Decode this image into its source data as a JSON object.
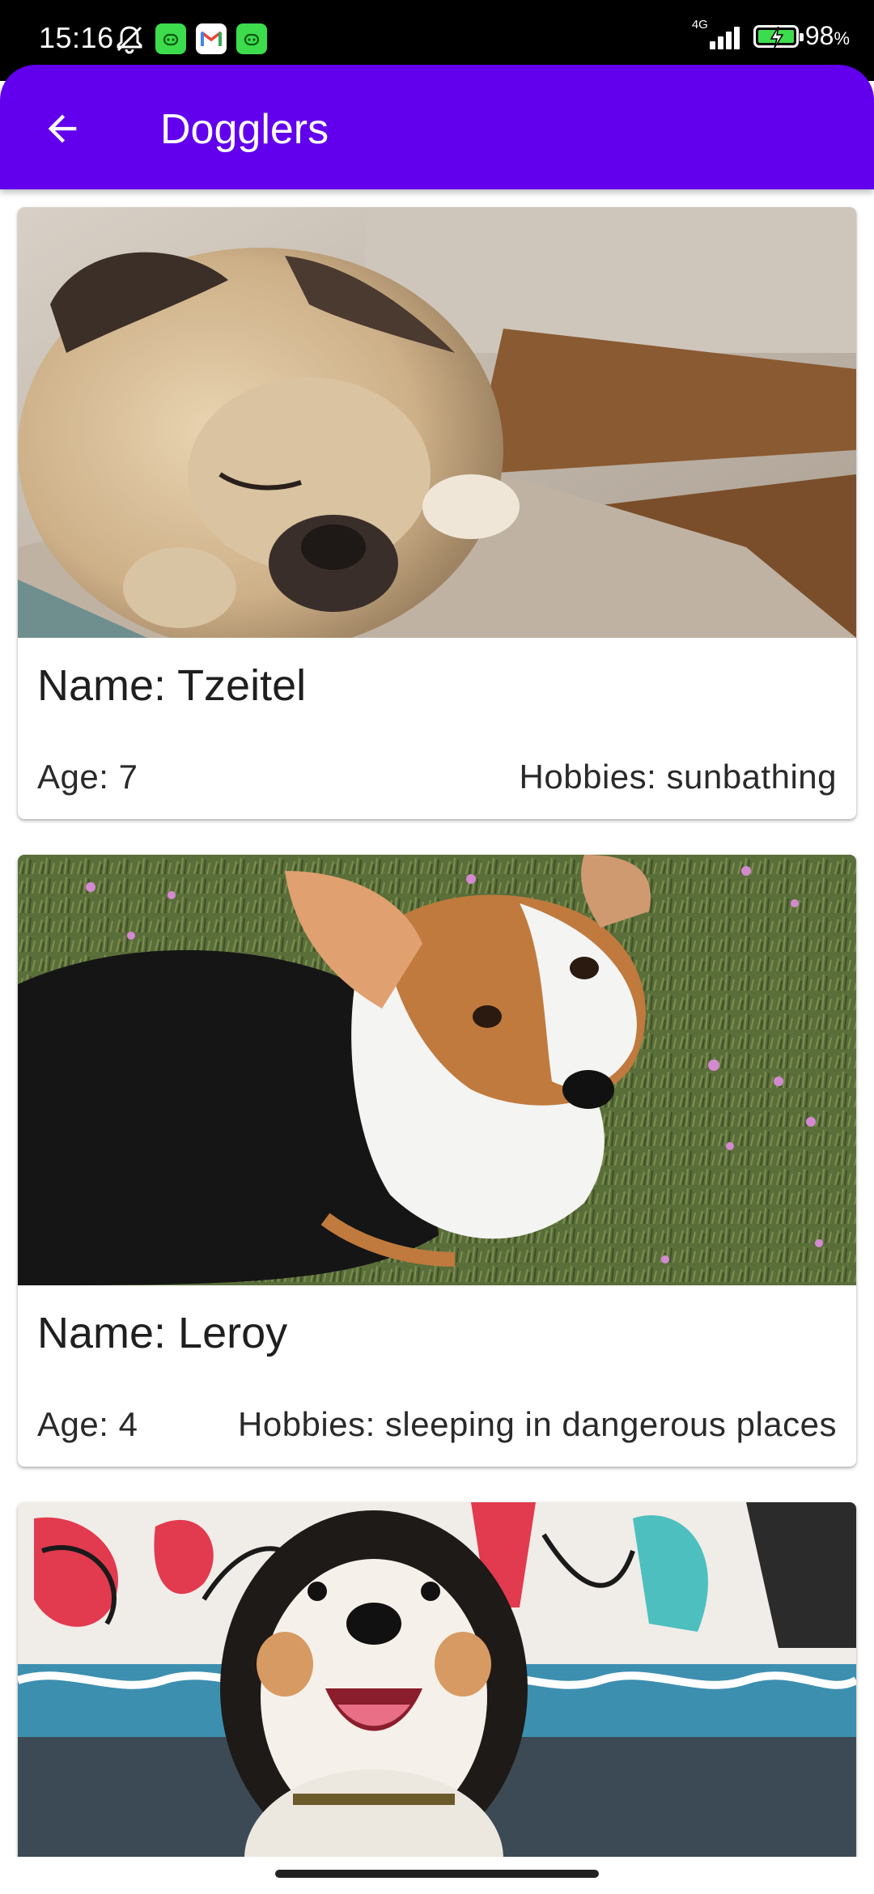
{
  "status_bar": {
    "time": "15:16",
    "network": "4G",
    "battery_percent": "98",
    "battery_unit": "%",
    "icons": [
      "notifications-off-icon",
      "android-app-icon",
      "gmail-icon",
      "android-app-icon",
      "signal-icon",
      "battery-charging-icon"
    ]
  },
  "app_bar": {
    "title": "Dogglers",
    "nav_icon": "arrow-back-icon"
  },
  "dogs": [
    {
      "name": "Name: Tzeitel",
      "age": "Age: 7",
      "hobbies": "Hobbies: sunbathing",
      "photo": "sleeping pug on cushion"
    },
    {
      "name": "Name: Leroy",
      "age": "Age: 4",
      "hobbies": "Hobbies: sleeping in dangerous places",
      "photo": "corgi on grass"
    },
    {
      "photo": "fluffy dog in front of graffiti wall"
    }
  ],
  "colors": {
    "primary": "#6200ee",
    "status_bar": "#000000",
    "surface": "#ffffff"
  }
}
